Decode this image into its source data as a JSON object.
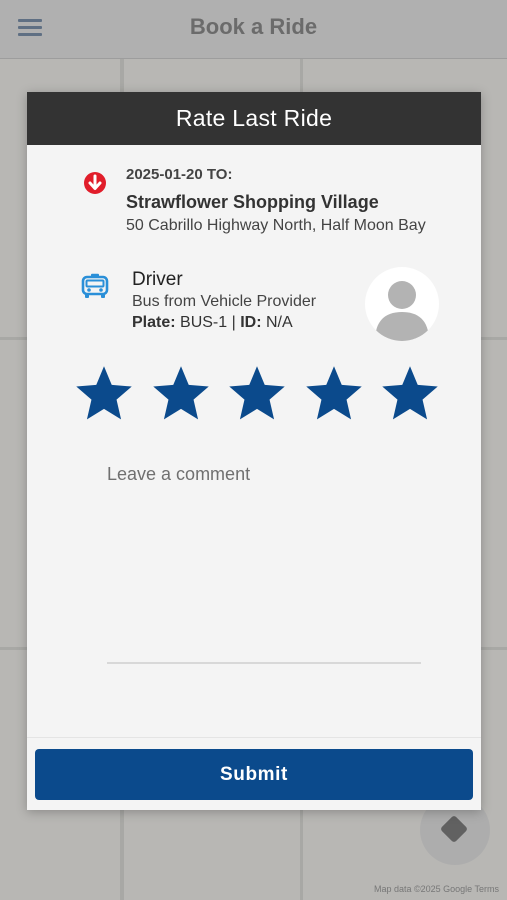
{
  "background": {
    "title": "Book a Ride",
    "map_credit": "Map data ©2025 Google   Terms"
  },
  "modal": {
    "title": "Rate Last Ride",
    "trip": {
      "date_line": "2025-01-20 TO:",
      "destination": "Strawflower Shopping Village",
      "address": "50 Cabrillo Highway North, Half Moon Bay",
      "icon": "destination-pin-icon"
    },
    "driver": {
      "title": "Driver",
      "provider": "Bus from Vehicle Provider",
      "plate_label": "Plate:",
      "plate_value": "BUS-1",
      "separator": "|",
      "id_label": "ID:",
      "id_value": "N/A",
      "icon": "taxi-icon",
      "avatar": "default-avatar"
    },
    "rating": {
      "value": 5,
      "max": 5,
      "star_color": "#0b4a8c"
    },
    "comment": {
      "placeholder": "Leave a comment",
      "value": ""
    },
    "submit_label": "Submit"
  },
  "colors": {
    "header_bg": "#333333",
    "primary": "#0b4a8c",
    "pin_red": "#e11d2a",
    "taxi_blue": "#2a8fd8"
  }
}
